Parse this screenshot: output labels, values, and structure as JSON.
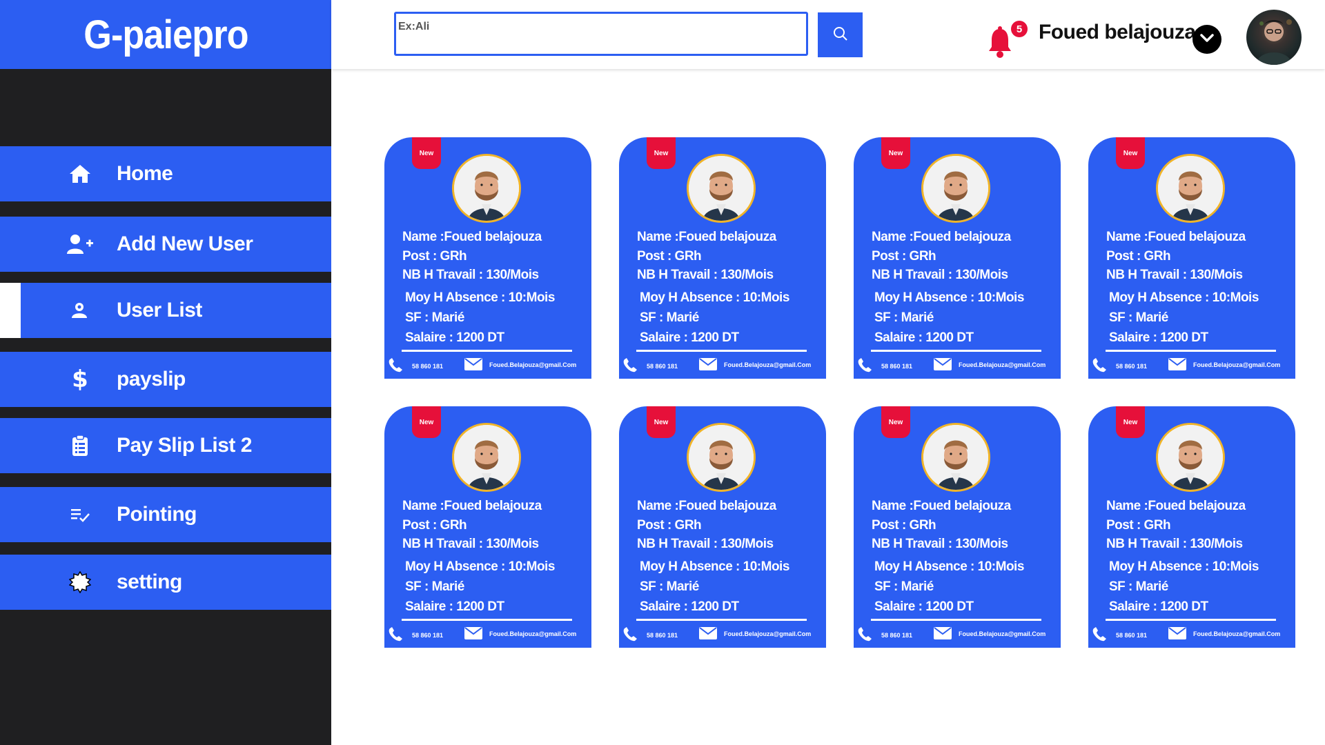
{
  "brand": "G-paiepro",
  "sidebar": {
    "items": [
      {
        "label": "Home",
        "icon": "home-icon"
      },
      {
        "label": "Add New User",
        "icon": "user-plus-icon"
      },
      {
        "label": "User List",
        "icon": "user-list-icon",
        "active": true
      },
      {
        "label": "payslip",
        "icon": "dollar-icon"
      },
      {
        "label": "Pay Slip List 2",
        "icon": "clipboard-icon"
      },
      {
        "label": "Pointing",
        "icon": "checklist-icon"
      },
      {
        "label": "setting",
        "icon": "settings-icon"
      }
    ]
  },
  "header": {
    "search_placeholder": "Ex:Ali",
    "notification_count": "5",
    "user_name": "Foued belajouza"
  },
  "cards": [
    {
      "badge": "New",
      "name": "Name :Foued belajouza",
      "post": "Post  : GRh",
      "travail": "NB H  Travail  : 130/Mois",
      "absence": "Moy H  Absence : 10:Mois",
      "sf": "SF : Marié",
      "salaire": "Salaire : 1200 DT",
      "phone": "58 860 181",
      "email": "Foued.Belajouza@gmail.Com"
    },
    {
      "badge": "New",
      "name": "Name :Foued belajouza",
      "post": "Post  : GRh",
      "travail": "NB H  Travail  : 130/Mois",
      "absence": "Moy H  Absence : 10:Mois",
      "sf": "SF : Marié",
      "salaire": "Salaire : 1200 DT",
      "phone": "58 860 181",
      "email": "Foued.Belajouza@gmail.Com"
    },
    {
      "badge": "New",
      "name": "Name :Foued belajouza",
      "post": "Post  : GRh",
      "travail": "NB H  Travail  : 130/Mois",
      "absence": "Moy H  Absence : 10:Mois",
      "sf": "SF : Marié",
      "salaire": "Salaire : 1200 DT",
      "phone": "58 860 181",
      "email": "Foued.Belajouza@gmail.Com"
    },
    {
      "badge": "New",
      "name": "Name :Foued belajouza",
      "post": "Post  : GRh",
      "travail": "NB H  Travail  : 130/Mois",
      "absence": "Moy H  Absence : 10:Mois",
      "sf": "SF : Marié",
      "salaire": "Salaire : 1200 DT",
      "phone": "58 860 181",
      "email": "Foued.Belajouza@gmail.Com"
    },
    {
      "badge": "New",
      "name": "Name :Foued belajouza",
      "post": "Post  : GRh",
      "travail": "NB H  Travail  : 130/Mois",
      "absence": "Moy H  Absence : 10:Mois",
      "sf": "SF : Marié",
      "salaire": "Salaire : 1200 DT",
      "phone": "58 860 181",
      "email": "Foued.Belajouza@gmail.Com"
    },
    {
      "badge": "New",
      "name": "Name :Foued belajouza",
      "post": "Post  : GRh",
      "travail": "NB H  Travail  : 130/Mois",
      "absence": "Moy H  Absence : 10:Mois",
      "sf": "SF : Marié",
      "salaire": "Salaire : 1200 DT",
      "phone": "58 860 181",
      "email": "Foued.Belajouza@gmail.Com"
    },
    {
      "badge": "New",
      "name": "Name :Foued belajouza",
      "post": "Post  : GRh",
      "travail": "NB H  Travail  : 130/Mois",
      "absence": "Moy H  Absence : 10:Mois",
      "sf": "SF : Marié",
      "salaire": "Salaire : 1200 DT",
      "phone": "58 860 181",
      "email": "Foued.Belajouza@gmail.Com"
    },
    {
      "badge": "New",
      "name": "Name :Foued belajouza",
      "post": "Post  : GRh",
      "travail": "NB H  Travail  : 130/Mois",
      "absence": "Moy H  Absence : 10:Mois",
      "sf": "SF : Marié",
      "salaire": "Salaire : 1200 DT",
      "phone": "58 860 181",
      "email": "Foued.Belajouza@gmail.Com"
    }
  ],
  "colors": {
    "primary": "#2c5ef2",
    "sidebar_bg": "#1f1f21",
    "badge": "#e6103a",
    "photo_ring": "#f0b429"
  }
}
